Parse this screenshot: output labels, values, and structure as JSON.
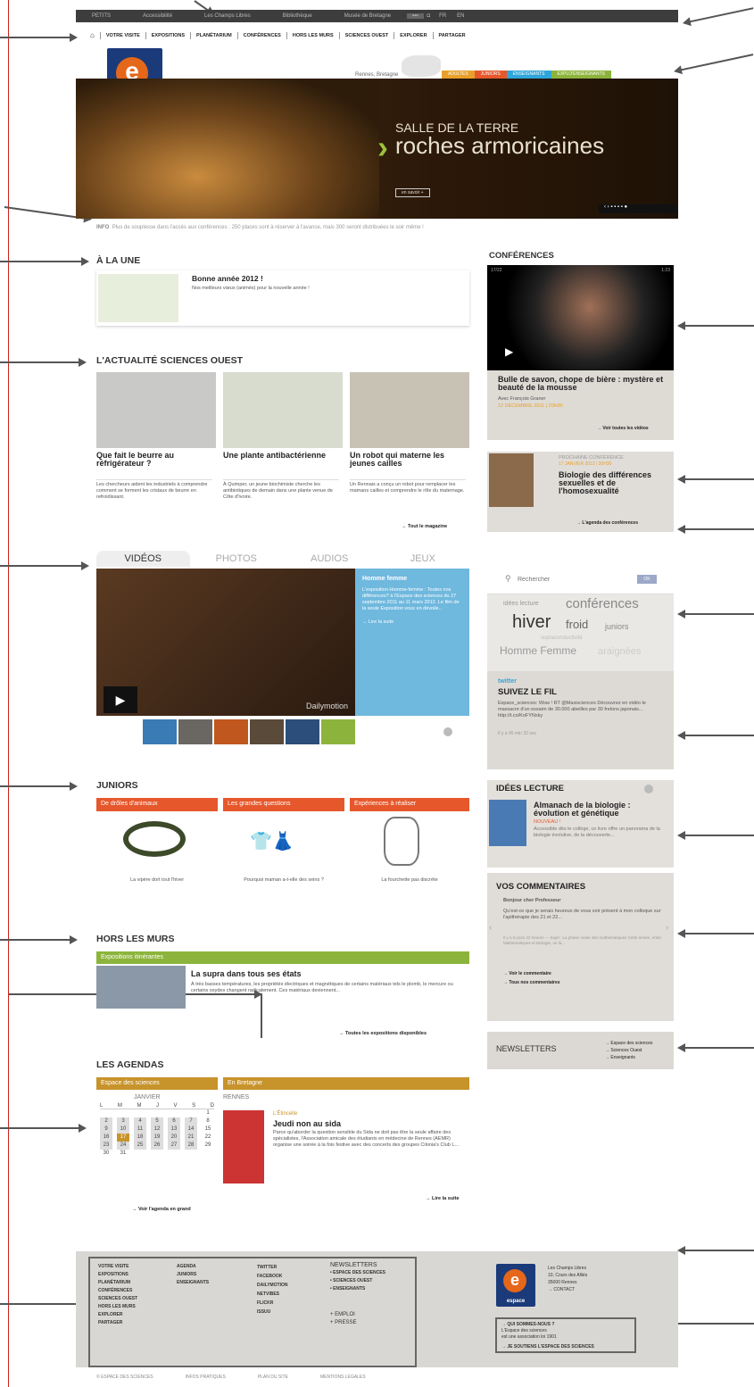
{
  "topbar": {
    "items": [
      "PETITS",
      "Accessibilité",
      "Les Champs Libres",
      "Bibliothèque",
      "Musée de Bretagne"
    ],
    "lang": [
      "FR",
      "EN"
    ]
  },
  "nav": {
    "items": [
      "VOTRE VISITE",
      "EXPOSITIONS",
      "PLANÉTARIUM",
      "CONFÉRENCES",
      "HORS LES MURS",
      "SCIENCES OUEST",
      "EXPLORER",
      "PARTAGER"
    ]
  },
  "logo": {
    "letter": "e",
    "text": "espace"
  },
  "location": "Rennes, Bretagne",
  "audiences": [
    {
      "label": "ADULTES",
      "color": "#e8a02b"
    },
    {
      "label": "JUNIORS",
      "color": "#e6582c"
    },
    {
      "label": "ENSEIGNANTS",
      "color": "#2fa6d9"
    },
    {
      "label": "EXPLO'ENSEIGNANTS",
      "color": "#8cb43c"
    }
  ],
  "hero": {
    "subtitle": "SALLE DE LA TERRE",
    "title": "roches armoricaines",
    "button": "en savoir +"
  },
  "info": {
    "label": "INFO",
    "text": "Plus de souplesse dans l'accès aux conférences : 250 places sont à réserver à l'avance, mais 300 seront distribuées le soir même !"
  },
  "une": {
    "heading": "À LA UNE",
    "title": "Bonne année 2012 !",
    "text": "Nos meilleurs vœux (animés) pour la nouvelle année !"
  },
  "actu": {
    "heading": "L'ACTUALITÉ SCIENCES OUEST",
    "articles": [
      {
        "title": "Que fait le beurre au réfrigérateur ?",
        "text": "Les chercheurs aident les industriels à comprendre comment se forment les cristaux de beurre en refroidissant."
      },
      {
        "title": "Une plante antibactérienne",
        "text": "À Quimper, un jeune biochimiste cherche les antibiotiques de demain dans une plante venue de Côte d'Ivoire."
      },
      {
        "title": "Un robot qui materne les jeunes cailles",
        "text": "Un Rennais a conçu un robot pour remplacer les mamans cailles et comprendre le rôle du maternage."
      }
    ],
    "more": "→ Tout le magazine"
  },
  "media": {
    "tabs": [
      "VIDÉOS",
      "PHOTOS",
      "AUDIOS",
      "JEUX"
    ],
    "side_title": "Homme femme",
    "side_text": "L'exposition Homme-femme : Toutes nos différences? à l'Espace des sciences du 27 septembre 2011 au 11 mars 2012. Le film de la seule Exposition vous en dévoile...",
    "side_more": "→ Lire la suite",
    "brand": "Dailymotion"
  },
  "juniors": {
    "heading": "JUNIORS",
    "cards": [
      {
        "tag": "De drôles d'animaux",
        "caption": "La vipère dort tout l'hiver"
      },
      {
        "tag": "Les grandes questions",
        "caption": "Pourquoi maman a-t-elle des seins ?"
      },
      {
        "tag": "Expériences à réaliser",
        "caption": "La fourchette pas discrète"
      }
    ]
  },
  "horsmurs": {
    "heading": "HORS LES MURS",
    "tag": "Expositions itinérantes",
    "title": "La supra dans tous ses états",
    "text": "À très basses températures, les propriétés électriques et magnétiques de certains matériaux tels le plomb, le mercure ou certains oxydes changent radicalement. Ces matériaux deviennent...",
    "more": "→ Toutes les expositions disponibles"
  },
  "agendas": {
    "heading": "LES AGENDAS",
    "tab1": "Espace des sciences",
    "tab2": "En Bretagne",
    "month": "JANVIER",
    "days": [
      "L",
      "M",
      "M",
      "J",
      "V",
      "S",
      "D"
    ],
    "weeks": [
      [
        "",
        "",
        "",
        "",
        "",
        "",
        "1"
      ],
      [
        "2",
        "3",
        "4",
        "5",
        "6",
        "7",
        "8"
      ],
      [
        "9",
        "10",
        "11",
        "12",
        "13",
        "14",
        "15"
      ],
      [
        "16",
        "17",
        "18",
        "19",
        "20",
        "21",
        "22"
      ],
      [
        "23",
        "24",
        "25",
        "26",
        "27",
        "28",
        "29"
      ],
      [
        "30",
        "31",
        "",
        "",
        "",
        "",
        ""
      ]
    ],
    "today": "17",
    "cal_more": "→ Voir l'agenda en grand",
    "city": "RENNES",
    "event_type": "L'Étincelle",
    "event_title": "Jeudi non au sida",
    "event_text": "Parce qu'aborder la question sensible du Sida ne doit pas être la seule affaire des spécialistes, l'Association amicale des étudiants en médecine de Rennes (AEMR) organise une soirée à la fois festive avec des concerts des groupes Cilonia's Club L...",
    "event_more": "→ Lire la suite"
  },
  "conf": {
    "heading": "CONFÉRENCES",
    "time_a": "17/22",
    "time_b": "1:23",
    "title": "Bulle de savon, chope de bière : mystère et beauté de la mousse",
    "author": "Avec François Graner",
    "date": "12 DÉCEMBRE 2011 | 20H30",
    "more": "→ Voir toutes les vidéos",
    "next_label": "PROCHAINE CONFÉRENCE",
    "next_date": "17 JANVIER 2012 | 20H30",
    "next_title": "Biologie des différences sexuelles et de l'homosexualité",
    "next_more": "→ L'agenda des conférences"
  },
  "search": {
    "placeholder": "Rechercher",
    "button": "OK"
  },
  "tags": {
    "t1": "idées lecture",
    "t2": "conférences",
    "t3": "hiver",
    "t4": "froid",
    "t5": "juniors",
    "t6": "supraconductivité",
    "t7": "Homme Femme",
    "t8": "araignées"
  },
  "twitter": {
    "brand": "twitter",
    "heading": "SUIVEZ LE FIL",
    "text": "Espace_sciences: Wow ! RT @Maxisciences Découvrez en vidéo le massacre d'un essaim de 30.000 abeilles par 30 frelons japonais... http://t.co/KoFYNxky",
    "time": "Il y a 45 min 32 sec"
  },
  "lecture": {
    "heading": "IDÉES LECTURE",
    "title": "Almanach de la biologie : évolution et génétique",
    "badge": "NOUVEAU !",
    "text": "Accessible dès le collège, ce livre offre un panorama de la biologie évolutive, de la découverte..."
  },
  "comments": {
    "heading": "VOS COMMENTAIRES",
    "greet": "Bonjour cher Professeur",
    "text": "Qu'est-ce que je serais heureux de vous voir présent à mon colloque sur l'apithérapie des 21 et 22...",
    "meta": "Il y a 6 jours 22 heures — Sujet : La phase oraler des mathématiques Cette année, entre Mathématiques et Biologie, on la... ",
    "l1": "→ Voir le commentaire",
    "l2": "→ Tous nos commentaires"
  },
  "newsletters": {
    "heading": "NEWSLETTERS",
    "items": [
      "→ Espace des sciences",
      "→ Sciences Ouest",
      "→ Enseignants"
    ]
  },
  "footer": {
    "col1": [
      "VOTRE VISITE",
      "EXPOSITIONS",
      "PLANÉTARIUM",
      "CONFÉRENCES",
      "SCIENCES OUEST",
      "HORS LES MURS",
      "EXPLORER",
      "PARTAGER"
    ],
    "col2": [
      "AGENDA",
      "JUNIORS",
      "ENSEIGNANTS"
    ],
    "social": [
      "TWITTER",
      "FACEBOOK",
      "DAILYMOTION",
      "NETVIBES",
      "FLICKR",
      "ISSUU"
    ],
    "nl_title": "NEWSLETTERS",
    "nl": [
      "• ESPACE DES SCIENCES",
      "• SCIENCES OUEST",
      "• ENSEIGNANTS"
    ],
    "emploi": "+ EMPLOI",
    "presse": "+ PRESSE",
    "addr": [
      "Les Champs Libres",
      "10, Cours des Alliés",
      "35000 Rennes",
      "→ CONTACT"
    ],
    "who1": "→ QUI SOMMES-NOUS ?",
    "who2": "L'Espace des sciences",
    "who3": "est une association loi 1901",
    "support": "→ JE SOUTIENS L'ESPACE DES SCIENCES"
  },
  "bottom": [
    "© ESPACE DES SCIENCES",
    "INFOS PRATIQUES",
    "PLAN DU SITE",
    "MENTIONS LÉGALES"
  ]
}
